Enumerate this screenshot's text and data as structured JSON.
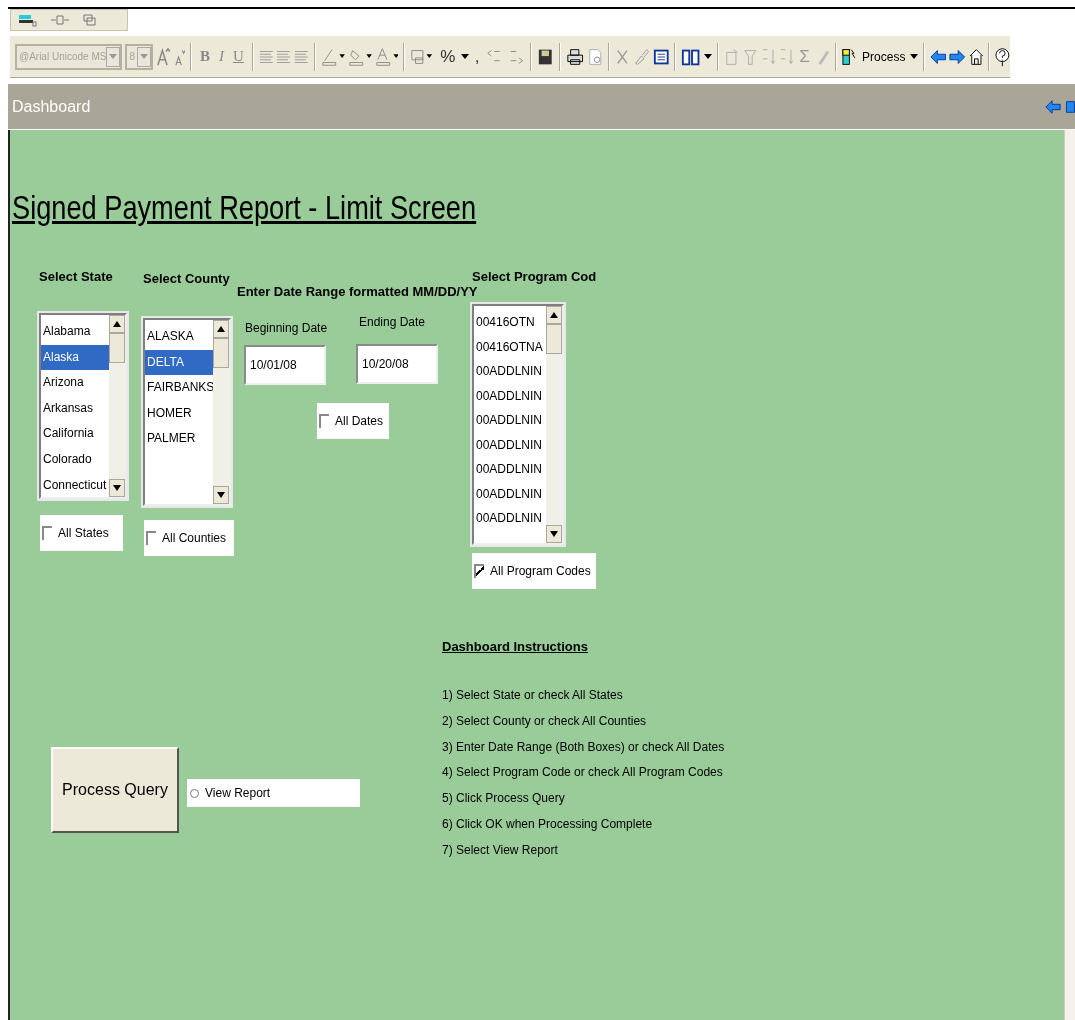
{
  "toolbar": {
    "font": "@Arial Unicode MS",
    "size": "8",
    "format_glyphs": [
      "B",
      "I",
      "U"
    ],
    "percent": "%",
    "comma": ",",
    "sum": "Σ",
    "process": "Process"
  },
  "header": {
    "title": "Dashboard"
  },
  "form": {
    "title": "Signed Payment Report - Limit Screen",
    "state": {
      "label": "Select State",
      "items": [
        {
          "text": "Alabama",
          "selected": false
        },
        {
          "text": "Alaska",
          "selected": true
        },
        {
          "text": "Arizona",
          "selected": false
        },
        {
          "text": "Arkansas",
          "selected": false
        },
        {
          "text": "California",
          "selected": false
        },
        {
          "text": "Colorado",
          "selected": false
        },
        {
          "text": "Connecticut",
          "selected": false
        }
      ],
      "all": {
        "label": "All States",
        "checked": false
      }
    },
    "county": {
      "label": "Select County",
      "items": [
        {
          "text": "ALASKA",
          "selected": false
        },
        {
          "text": "DELTA",
          "selected": true
        },
        {
          "text": "FAIRBANKS",
          "selected": false
        },
        {
          "text": "HOMER",
          "selected": false
        },
        {
          "text": "PALMER",
          "selected": false
        }
      ],
      "all": {
        "label": "All Counties",
        "checked": false
      }
    },
    "dates": {
      "label": "Enter Date Range formatted MM/DD/YY",
      "begin_label": "Beginning Date",
      "begin": "10/01/08",
      "end_label": "Ending Date",
      "end": "10/20/08",
      "all": {
        "label": "All Dates",
        "checked": false
      }
    },
    "program": {
      "label": "Select Program Cod",
      "items": [
        {
          "text": "00416OTN",
          "selected": false
        },
        {
          "text": "00416OTNA",
          "selected": false
        },
        {
          "text": "00ADDLNIN",
          "selected": false
        },
        {
          "text": "00ADDLNIN",
          "selected": false
        },
        {
          "text": "00ADDLNIN",
          "selected": false
        },
        {
          "text": "00ADDLNIN",
          "selected": false
        },
        {
          "text": "00ADDLNIN",
          "selected": false
        },
        {
          "text": "00ADDLNIN",
          "selected": false
        },
        {
          "text": "00ADDLNIN",
          "selected": false
        }
      ],
      "all": {
        "label": "All Program Codes",
        "checked": true
      }
    },
    "instructions": {
      "title": "Dashboard Instructions",
      "steps": [
        "1) Select State or check All States",
        "2) Select County or check All Counties",
        "3) Enter Date Range (Both Boxes) or check All Dates",
        "4) Select Program Code or check All Program Codes",
        "5) Click Process Query",
        "6) Click OK when Processing Complete",
        "7) Select View Report"
      ]
    },
    "process_button": "Process Query",
    "view_report": {
      "label": "View Report",
      "selected": false
    }
  }
}
